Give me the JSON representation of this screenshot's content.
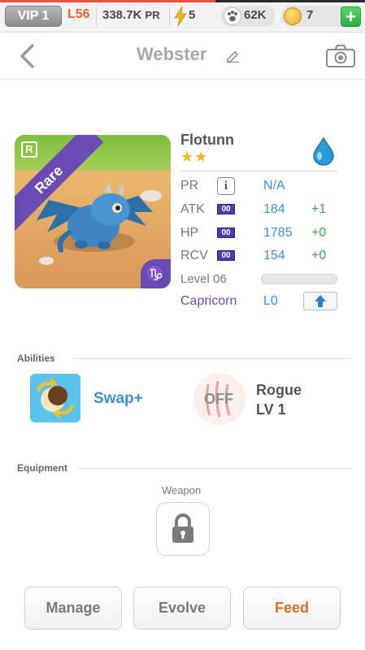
{
  "status_bar": {
    "vip": "VIP 1",
    "level": "L56",
    "pr_value": "338.7K",
    "pr_unit": "PR",
    "energy": "5",
    "paws": "62K",
    "coins": "7",
    "plus": "+",
    "colors": {
      "level": "#e9642e",
      "plus": "#2fae45"
    }
  },
  "header": {
    "title": "Webster",
    "icons": {
      "back": "chevron-left-icon",
      "edit": "pencil-icon",
      "camera": "camera-icon"
    }
  },
  "creature": {
    "rarity": "Rare",
    "rarity_badge": "R",
    "zodiac_symbol": "♑",
    "name": "Flotunn",
    "stars": "★★",
    "element_icon": "water-drop-icon",
    "stats": [
      {
        "label": "PR",
        "value": "N/A",
        "bonus": ""
      },
      {
        "label": "ATK",
        "badge": "00",
        "value": "184",
        "bonus": "+1"
      },
      {
        "label": "HP",
        "badge": "00",
        "value": "1785",
        "bonus": "+0"
      },
      {
        "label": "RCV",
        "badge": "00",
        "value": "154",
        "bonus": "+0"
      }
    ],
    "pr_info": "i",
    "level_label": "Level 06",
    "level_progress": 0,
    "sign": "Capricorn",
    "sign_level": "L0",
    "colors": {
      "rarity": "#6a4bb3",
      "value": "#3c8fd8",
      "bonus": "#3aa54a"
    }
  },
  "abilities": {
    "title": "Abilities",
    "items": [
      {
        "name": "Swap+"
      },
      {
        "state": "OFF",
        "name": "Rogue",
        "level": "LV 1"
      }
    ]
  },
  "equipment": {
    "title": "Equipment",
    "weapon_label": "Weapon",
    "weapon_icon": "lock-icon"
  },
  "actions": {
    "manage": "Manage",
    "evolve": "Evolve",
    "feed": "Feed",
    "colors": {
      "feed": "#e46a1f"
    }
  }
}
